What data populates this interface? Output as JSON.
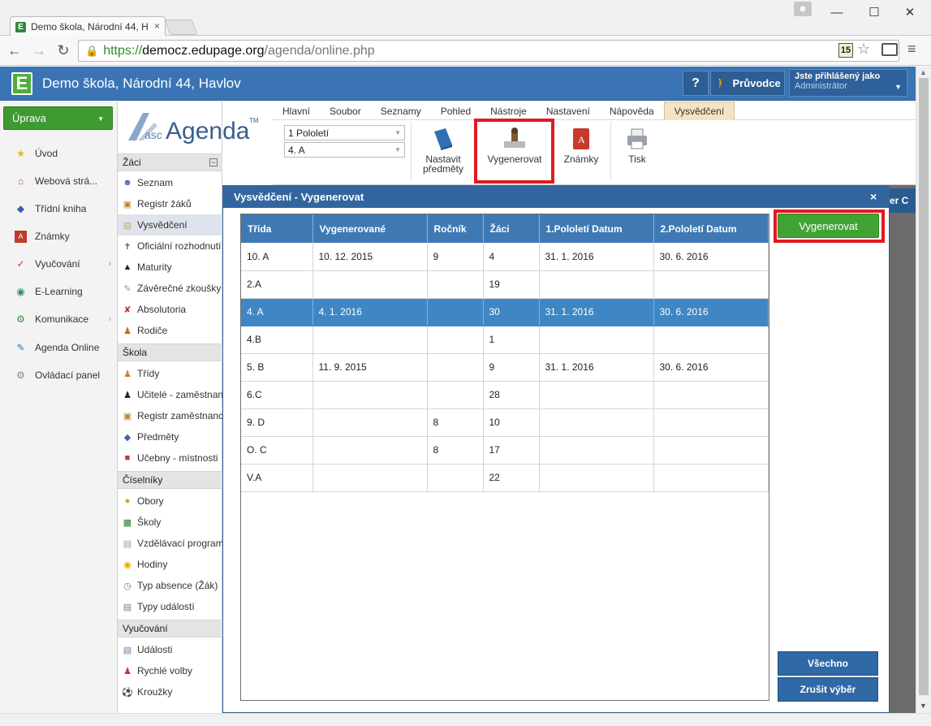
{
  "browser": {
    "tab_title": "Demo škola, Národní 44, H",
    "url_scheme": "https://",
    "url_host": "democz.edupage.org",
    "url_path": "/agenda/online.php",
    "ext_badge": "15"
  },
  "app": {
    "school_name": "Demo škola, Národní 44, Havlov",
    "help_label": "?",
    "guide_label": "Průvodce",
    "user_line1": "Jste přihlášený jako",
    "user_line2": "Administrátor"
  },
  "leftnav": {
    "uprava_label": "Úprava",
    "items": [
      {
        "label": "Úvod",
        "icon": "star-icon"
      },
      {
        "label": "Webová strá...",
        "icon": "web-icon"
      },
      {
        "label": "Třídní kniha",
        "icon": "book-icon"
      },
      {
        "label": "Známky",
        "icon": "grades-icon"
      },
      {
        "label": "Vyučování",
        "icon": "teaching-icon"
      },
      {
        "label": "E-Learning",
        "icon": "elearning-icon"
      },
      {
        "label": "Komunikace",
        "icon": "communication-icon"
      },
      {
        "label": "Agenda Online",
        "icon": "agenda-icon"
      },
      {
        "label": "Ovládací panel",
        "icon": "control-panel-icon"
      }
    ]
  },
  "sidebar": {
    "logo_asc": "asc",
    "logo_agenda": "Agenda",
    "logo_tm": "TM",
    "sections": {
      "zaci": "Žáci",
      "skola": "Škola",
      "ciselniky": "Číselníky",
      "vyucovani": "Vyučování"
    },
    "zaci_items": [
      "Seznam",
      "Registr žáků",
      "Vysvědčení",
      "Oficiální rozhodnutí",
      "Maturity",
      "Závěrečné zkoušky",
      "Absolutoria",
      "Rodiče"
    ],
    "skola_items": [
      "Třídy",
      "Učitelé - zaměstnanci",
      "Registr zaměstnanců",
      "Předměty",
      "Učebny - místnosti"
    ],
    "ciselniky_items": [
      "Obory",
      "Školy",
      "Vzdělávací programy",
      "Hodiny",
      "Typ absence (Žák)",
      "Typy událostí"
    ],
    "vyucovani_items": [
      "Události",
      "Rychlé volby",
      "Kroužky"
    ]
  },
  "menu": {
    "tabs": [
      "Hlavní",
      "Soubor",
      "Seznamy",
      "Pohled",
      "Nástroje",
      "Nastavení",
      "Nápověda",
      "Vysvědčení"
    ]
  },
  "ribbon": {
    "period_value": "1 Pololetí",
    "class_value": "4. A",
    "btn_subjects_l1": "Nastavit",
    "btn_subjects_l2": "předměty",
    "btn_generate": "Vygenerovat",
    "btn_grades": "Známky",
    "btn_print": "Tisk"
  },
  "modal": {
    "title": "Vysvědčení - Vygenerovat",
    "close": "×",
    "generate_button": "Vygenerovat",
    "all_button": "Všechno",
    "cancel_button": "Zrušit výběr",
    "right_strip": "er C",
    "columns": [
      "Třída",
      "Vygenerované",
      "Ročník",
      "Žáci",
      "1.Pololetí Datum",
      "2.Pololetí Datum"
    ],
    "rows": [
      [
        "10. A",
        "10. 12. 2015",
        "9",
        "4",
        "31. 1. 2016",
        "30. 6. 2016"
      ],
      [
        "2.A",
        "",
        "",
        "19",
        "",
        ""
      ],
      [
        "4. A",
        "4. 1. 2016",
        "",
        "30",
        "31. 1. 2016",
        "30. 6. 2016"
      ],
      [
        "4.B",
        "",
        "",
        "1",
        "",
        ""
      ],
      [
        "5. B",
        "11. 9. 2015",
        "",
        "9",
        "31. 1. 2016",
        "30. 6. 2016"
      ],
      [
        "6.C",
        "",
        "",
        "28",
        "",
        ""
      ],
      [
        "9. D",
        "",
        "8",
        "10",
        "",
        ""
      ],
      [
        "O. C",
        "",
        "8",
        "17",
        "",
        ""
      ],
      [
        "V.A",
        "",
        "",
        "22",
        "",
        ""
      ]
    ],
    "selected_row": 2
  },
  "colors": {
    "header_blue": "#3a74b5",
    "table_header": "#3f79b3",
    "selected_row": "#3f87c4",
    "green_button": "#42a335",
    "highlight_red": "#e01a22"
  }
}
